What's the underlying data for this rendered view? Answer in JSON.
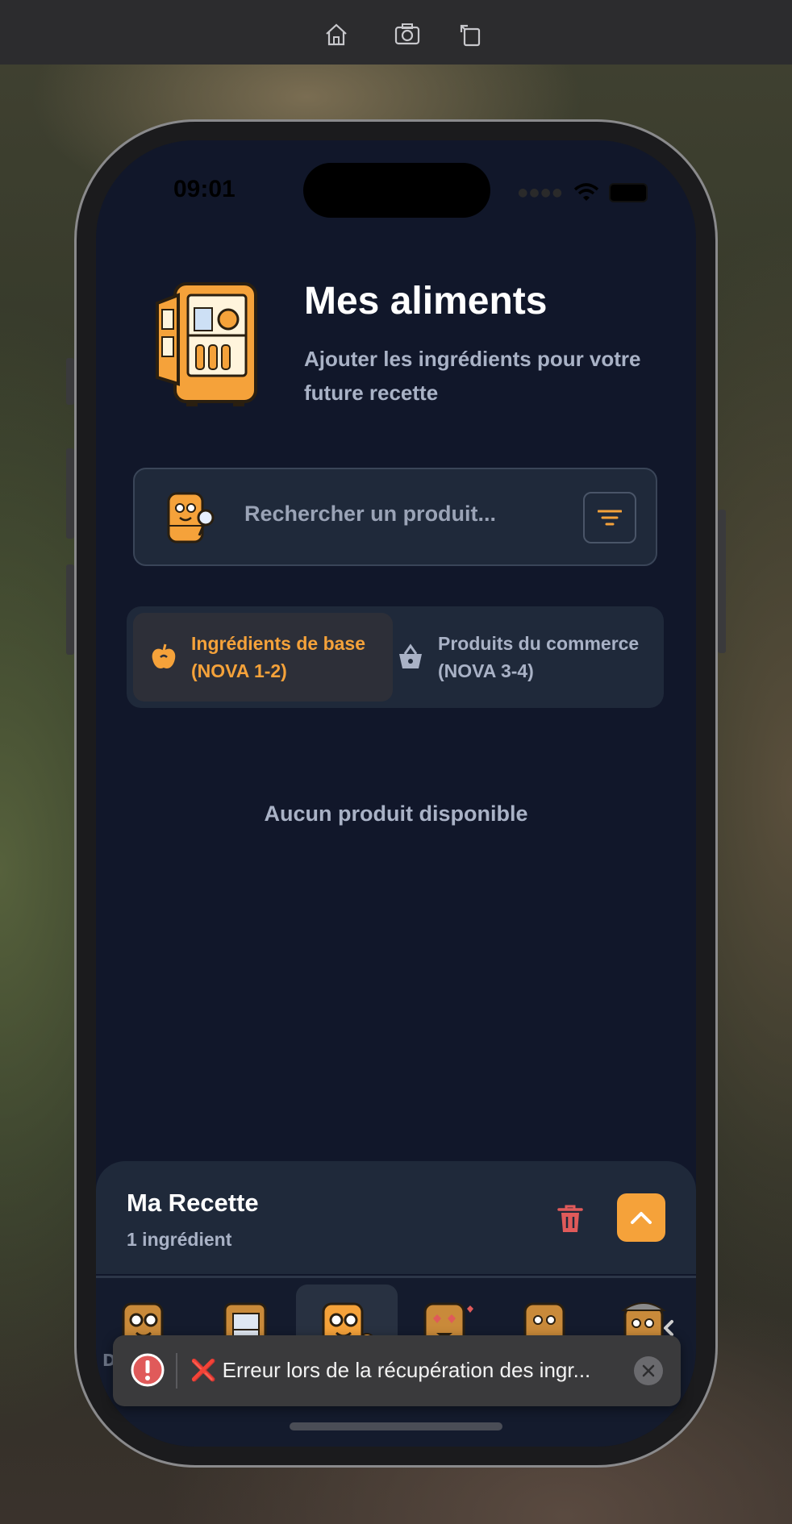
{
  "simulator_toolbar": {
    "icons": [
      "home-icon",
      "screenshot-icon",
      "rotate-icon"
    ]
  },
  "status_bar": {
    "time": "09:01",
    "icons": [
      "wifi-icon",
      "battery-icon"
    ]
  },
  "header": {
    "title": "Mes aliments",
    "subtitle": "Ajouter les ingrédients pour votre future recette"
  },
  "search": {
    "placeholder": "Rechercher un produit...",
    "filter_icon": "filter-icon"
  },
  "tabs": [
    {
      "label_line1": "Ingrédients de base",
      "label_line2": "(NOVA 1-2)",
      "icon": "apple-icon",
      "active": true
    },
    {
      "label_line1": "Produits du commerce",
      "label_line2": "(NOVA 3-4)",
      "icon": "basket-icon",
      "active": false
    }
  ],
  "empty_state": "Aucun produit disponible",
  "recipe_panel": {
    "title": "Ma Recette",
    "count": "1 ingrédient"
  },
  "bottom_nav": {
    "items": [
      "nav-mascot-glasses",
      "nav-mascot-fridge",
      "nav-mascot-apple",
      "nav-mascot-love",
      "nav-mascot-gear",
      "nav-mascot-wrench"
    ],
    "partial_label": "D",
    "active_index": 2
  },
  "toast": {
    "message": "❌ Erreur lors de la récupération des ingr..."
  },
  "colors": {
    "background": "#11172a",
    "card": "#1f293a",
    "accent": "#f5a23a",
    "text_muted": "#a9b2c6",
    "danger": "#e05a5a"
  }
}
